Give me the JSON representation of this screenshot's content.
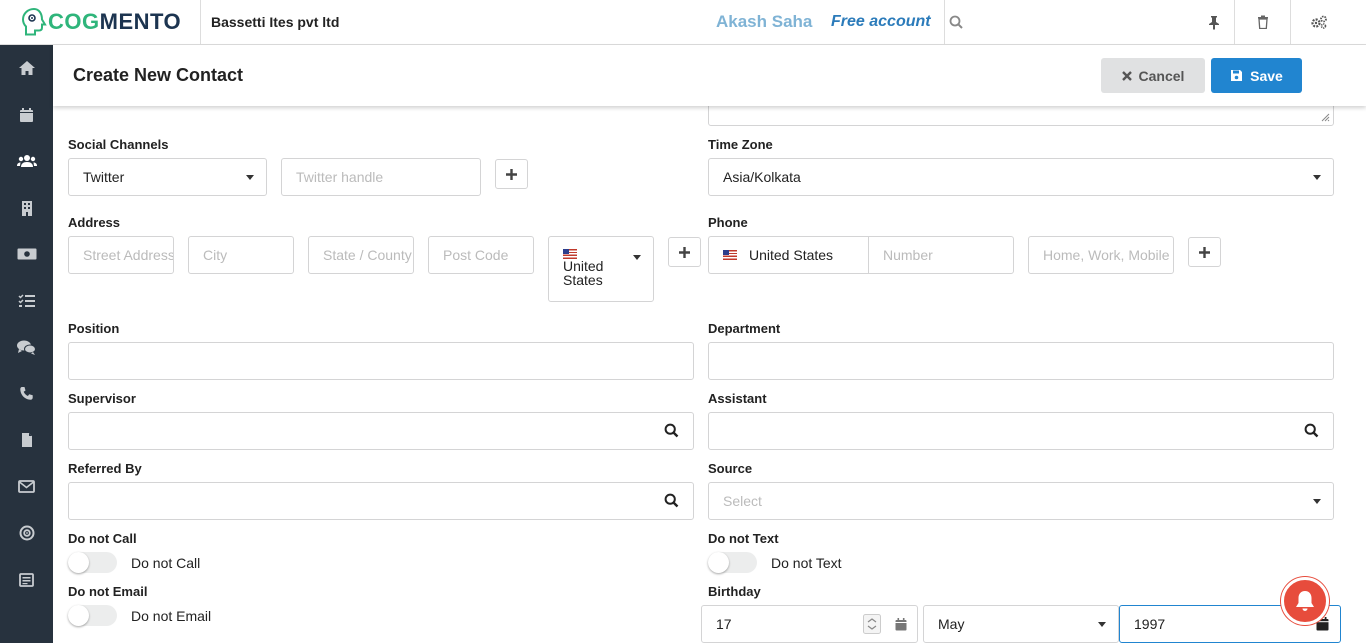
{
  "brand": {
    "logo_part1": "COG",
    "logo_part2": "MENTO"
  },
  "topbar": {
    "company": "Bassetti Ites pvt ltd",
    "user_name": "Akash Saha",
    "account_type": "Free account"
  },
  "header": {
    "title": "Create New Contact",
    "cancel_label": "Cancel",
    "save_label": "Save"
  },
  "sidebar": {
    "items": [
      "home-icon",
      "calendar-icon",
      "users-icon",
      "building-icon",
      "money-icon",
      "tasks-icon",
      "chat-icon",
      "phone-icon",
      "document-icon",
      "mail-icon",
      "target-icon",
      "form-icon"
    ]
  },
  "form": {
    "social_channels": {
      "label": "Social Channels",
      "channel": "Twitter",
      "handle_placeholder": "Twitter handle"
    },
    "time_zone": {
      "label": "Time Zone",
      "value": "Asia/Kolkata"
    },
    "address": {
      "label": "Address",
      "street_placeholder": "Street Address",
      "city_placeholder": "City",
      "state_placeholder": "State / County",
      "post_placeholder": "Post Code",
      "country": "United States"
    },
    "phone": {
      "label": "Phone",
      "country": "United States",
      "number_placeholder": "Number",
      "type_placeholder": "Home, Work, Mobile"
    },
    "position": {
      "label": "Position"
    },
    "department": {
      "label": "Department"
    },
    "supervisor": {
      "label": "Supervisor"
    },
    "assistant": {
      "label": "Assistant"
    },
    "referred_by": {
      "label": "Referred By"
    },
    "source": {
      "label": "Source",
      "placeholder": "Select"
    },
    "do_not_call": {
      "label": "Do not Call",
      "toggle_label": "Do not Call"
    },
    "do_not_text": {
      "label": "Do not Text",
      "toggle_label": "Do not Text"
    },
    "do_not_email": {
      "label": "Do not Email",
      "toggle_label": "Do not Email"
    },
    "birthday": {
      "label": "Birthday",
      "day": "17",
      "month": "May",
      "year": "1997"
    }
  },
  "colors": {
    "primary": "#2185d0",
    "sidebar": "#27323e",
    "brand_green": "#2fb57b",
    "notification": "#e74c3c"
  }
}
